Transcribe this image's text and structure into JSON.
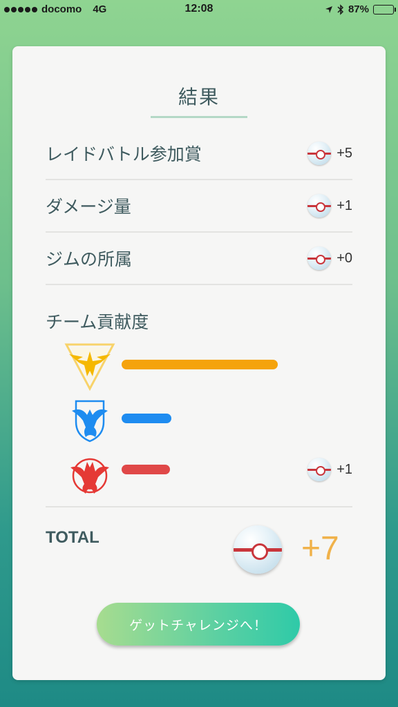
{
  "status_bar": {
    "carrier": "docomo",
    "network": "4G",
    "time": "12:08",
    "battery": "87%",
    "battery_level": 0.87
  },
  "title": "結果",
  "rows": [
    {
      "label": "レイドバトル参加賞",
      "reward": "+5"
    },
    {
      "label": "ダメージ量",
      "reward": "+1"
    },
    {
      "label": "ジムの所属",
      "reward": "+0"
    }
  ],
  "team_section": {
    "label": "チーム貢献度",
    "teams": [
      {
        "name": "instinct",
        "color": "#f5a30c",
        "contribution": 1.0,
        "reward": ""
      },
      {
        "name": "mystic",
        "color": "#1e8cf0",
        "contribution": 0.32,
        "reward": ""
      },
      {
        "name": "valor",
        "color": "#e04848",
        "contribution": 0.31,
        "reward": "+1"
      }
    ]
  },
  "total": {
    "label": "TOTAL",
    "value": "+7"
  },
  "cta_button": "ゲットチャレンジへ！",
  "colors": {
    "accent_orange": "#f0b24a",
    "text": "#3f5b5f",
    "ball_band": "#c9363c"
  },
  "icons": [
    "location-arrow-icon",
    "bluetooth-icon",
    "battery-icon",
    "premier-ball-icon",
    "team-instinct-icon",
    "team-mystic-icon",
    "team-valor-icon"
  ]
}
